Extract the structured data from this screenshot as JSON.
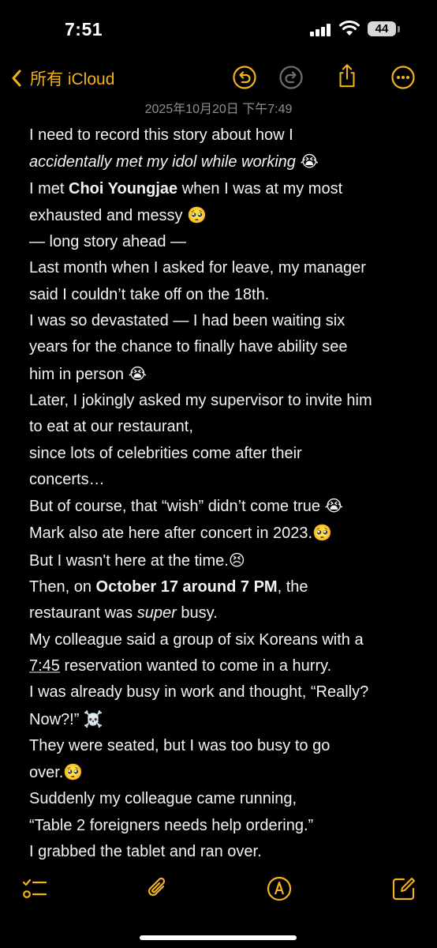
{
  "status_bar": {
    "time": "7:51",
    "battery": "44"
  },
  "nav": {
    "back_label": "所有 iCloud"
  },
  "note": {
    "date": "2025年10月20日 下午7:49",
    "lines": [
      {
        "pre": "I need to record this story about how I",
        "bold": "",
        "italic": "",
        "post": "",
        "emoji": ""
      },
      {
        "pre": "",
        "bold": "",
        "italic": "accidentally met my idol while working",
        "post": " ",
        "emoji": "😭"
      },
      {
        "pre": "I met ",
        "bold": "Choi Youngjae",
        "italic": "",
        "post": " when I was at my most",
        "emoji": ""
      },
      {
        "pre": "exhausted and messy ",
        "bold": "",
        "italic": "",
        "post": "",
        "emoji": "🥺"
      },
      {
        "pre": "— long story ahead —",
        "bold": "",
        "italic": "",
        "post": "",
        "emoji": ""
      },
      {
        "pre": "Last month when I asked for leave, my manager",
        "bold": "",
        "italic": "",
        "post": "",
        "emoji": ""
      },
      {
        "pre": "said I couldn’t take off on the 18th.",
        "bold": "",
        "italic": "",
        "post": "",
        "emoji": ""
      },
      {
        "pre": "I was so devastated — I had been waiting six",
        "bold": "",
        "italic": "",
        "post": "",
        "emoji": ""
      },
      {
        "pre": "years for the chance to finally have ability see",
        "bold": "",
        "italic": "",
        "post": "",
        "emoji": ""
      },
      {
        "pre": "him in person ",
        "bold": "",
        "italic": "",
        "post": "",
        "emoji": "😭"
      },
      {
        "pre": "Later, I jokingly asked my supervisor to invite him",
        "bold": "",
        "italic": "",
        "post": "",
        "emoji": ""
      },
      {
        "pre": "to eat at our restaurant,",
        "bold": "",
        "italic": "",
        "post": "",
        "emoji": ""
      },
      {
        "pre": "since lots of celebrities come after their",
        "bold": "",
        "italic": "",
        "post": "",
        "emoji": ""
      },
      {
        "pre": "concerts…",
        "bold": "",
        "italic": "",
        "post": "",
        "emoji": ""
      },
      {
        "pre": "But of course, that “wish” didn’t come true ",
        "bold": "",
        "italic": "",
        "post": "",
        "emoji": "😭"
      },
      {
        "pre": "Mark also ate here after concert in 2023.",
        "bold": "",
        "italic": "",
        "post": "",
        "emoji": "🥺"
      },
      {
        "pre": "But I wasn't here at the time.",
        "bold": "",
        "italic": "",
        "post": "",
        "emoji": "😣"
      },
      {
        "pre": "Then, on ",
        "bold": "October 17 around 7 PM",
        "italic": "",
        "post": ", the",
        "emoji": ""
      },
      {
        "pre": "restaurant was ",
        "bold": "",
        "italic": "super",
        "post": " busy.",
        "emoji": ""
      },
      {
        "pre": "My colleague said a group of six Koreans with a",
        "bold": "",
        "italic": "",
        "post": "",
        "emoji": ""
      },
      {
        "pre": "",
        "bold": "",
        "italic": "",
        "post": " reservation wanted to come in a hurry.",
        "emoji": "",
        "link": "7:45"
      },
      {
        "pre": "I was already busy in work and thought, “Really?",
        "bold": "",
        "italic": "",
        "post": "",
        "emoji": ""
      },
      {
        "pre": "Now?!” ",
        "bold": "",
        "italic": "",
        "post": "",
        "emoji": "☠️"
      },
      {
        "pre": "They were seated, but I was too busy to go",
        "bold": "",
        "italic": "",
        "post": "",
        "emoji": ""
      },
      {
        "pre": "over.",
        "bold": "",
        "italic": "",
        "post": "",
        "emoji": "🥺"
      },
      {
        "pre": "Suddenly my colleague came running,",
        "bold": "",
        "italic": "",
        "post": "",
        "emoji": ""
      },
      {
        "pre": "“Table 2 foreigners needs help ordering.”",
        "bold": "",
        "italic": "",
        "post": "",
        "emoji": ""
      },
      {
        "pre": "I grabbed the tablet and ran over.",
        "bold": "",
        "italic": "",
        "post": "",
        "emoji": ""
      }
    ]
  },
  "colors": {
    "accent": "#f2b21b",
    "background": "#000000",
    "text": "#f2f2f2",
    "date_text": "#8e8e93"
  },
  "icons": {
    "back": "chevron-left-icon",
    "undo": "undo-icon",
    "redo": "redo-icon",
    "share": "share-icon",
    "more": "more-icon",
    "checklist": "checklist-icon",
    "attachment": "paperclip-icon",
    "markup": "pen-icon",
    "compose": "compose-icon"
  }
}
